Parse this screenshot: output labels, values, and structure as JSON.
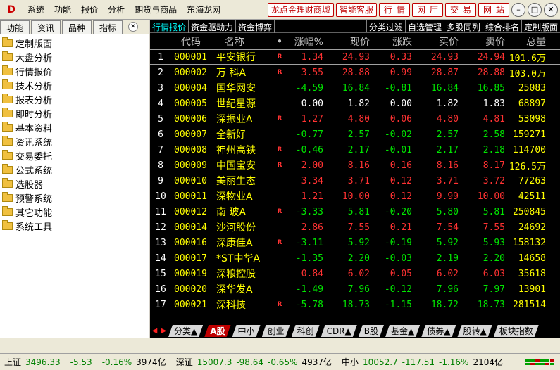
{
  "menubar": {
    "logo": "D",
    "items": [
      "系统",
      "功能",
      "报价",
      "分析",
      "期货与商品",
      "东海龙网"
    ],
    "ext_buttons": [
      "龙点金理财商城",
      "智能客服",
      "行情",
      "网厅",
      "交易",
      "网站"
    ],
    "window_buttons": [
      "minimize",
      "restore",
      "close"
    ]
  },
  "lefttabs": [
    "功能",
    "资讯",
    "品种",
    "指标"
  ],
  "tree": [
    "定制版面",
    "大盘分析",
    "行情报价",
    "技术分析",
    "报表分析",
    "即时分析",
    "基本资料",
    "资讯系统",
    "交易委托",
    "公式系统",
    "选股器",
    "预警系统",
    "其它功能",
    "系统工具"
  ],
  "viewtabs": {
    "left": [
      "行情报价",
      "资金驱动力",
      "资金博弈"
    ],
    "right": [
      "分类过滤",
      "自选管理",
      "多股同列",
      "综合排名",
      "定制版面"
    ]
  },
  "table": {
    "headers": {
      "code": "代码",
      "name": "名称",
      "dot": "•",
      "chg": "涨幅%",
      "price": "现价",
      "diff": "涨跌",
      "bid": "买价",
      "ask": "卖价",
      "vol": "总量"
    },
    "rows": [
      {
        "idx": "1",
        "code": "000001",
        "name": "平安银行",
        "flag": "R",
        "chg": "1.34",
        "price": "24.93",
        "diff": "0.33",
        "bid": "24.93",
        "ask": "24.94",
        "vol": "101.6万",
        "dir": "up"
      },
      {
        "idx": "2",
        "code": "000002",
        "name": "万 科A",
        "flag": "R",
        "chg": "3.55",
        "price": "28.88",
        "diff": "0.99",
        "bid": "28.87",
        "ask": "28.88",
        "vol": "103.0万",
        "dir": "up"
      },
      {
        "idx": "3",
        "code": "000004",
        "name": "国华网安",
        "flag": "",
        "chg": "-4.59",
        "price": "16.84",
        "diff": "-0.81",
        "bid": "16.84",
        "ask": "16.85",
        "vol": "25083",
        "dir": "down"
      },
      {
        "idx": "4",
        "code": "000005",
        "name": "世纪星源",
        "flag": "",
        "chg": "0.00",
        "price": "1.82",
        "diff": "0.00",
        "bid": "1.82",
        "ask": "1.83",
        "vol": "68897",
        "dir": "flat"
      },
      {
        "idx": "5",
        "code": "000006",
        "name": "深振业A",
        "flag": "R",
        "chg": "1.27",
        "price": "4.80",
        "diff": "0.06",
        "bid": "4.80",
        "ask": "4.81",
        "vol": "53098",
        "dir": "up"
      },
      {
        "idx": "6",
        "code": "000007",
        "name": "全新好",
        "flag": "",
        "chg": "-0.77",
        "price": "2.57",
        "diff": "-0.02",
        "bid": "2.57",
        "ask": "2.58",
        "vol": "159271",
        "dir": "down"
      },
      {
        "idx": "7",
        "code": "000008",
        "name": "神州高铁",
        "flag": "R",
        "chg": "-0.46",
        "price": "2.17",
        "diff": "-0.01",
        "bid": "2.17",
        "ask": "2.18",
        "vol": "114700",
        "dir": "down"
      },
      {
        "idx": "8",
        "code": "000009",
        "name": "中国宝安",
        "flag": "R",
        "chg": "2.00",
        "price": "8.16",
        "diff": "0.16",
        "bid": "8.16",
        "ask": "8.17",
        "vol": "126.5万",
        "dir": "up"
      },
      {
        "idx": "9",
        "code": "000010",
        "name": "美丽生态",
        "flag": "",
        "chg": "3.34",
        "price": "3.71",
        "diff": "0.12",
        "bid": "3.71",
        "ask": "3.72",
        "vol": "77263",
        "dir": "up"
      },
      {
        "idx": "10",
        "code": "000011",
        "name": "深物业A",
        "flag": "",
        "chg": "1.21",
        "price": "10.00",
        "diff": "0.12",
        "bid": "9.99",
        "ask": "10.00",
        "vol": "42511",
        "dir": "up"
      },
      {
        "idx": "11",
        "code": "000012",
        "name": "南 玻A",
        "flag": "R",
        "chg": "-3.33",
        "price": "5.81",
        "diff": "-0.20",
        "bid": "5.80",
        "ask": "5.81",
        "vol": "250845",
        "dir": "down"
      },
      {
        "idx": "12",
        "code": "000014",
        "name": "沙河股份",
        "flag": "",
        "chg": "2.86",
        "price": "7.55",
        "diff": "0.21",
        "bid": "7.54",
        "ask": "7.55",
        "vol": "24692",
        "dir": "up"
      },
      {
        "idx": "13",
        "code": "000016",
        "name": "深康佳A",
        "flag": "R",
        "chg": "-3.11",
        "price": "5.92",
        "diff": "-0.19",
        "bid": "5.92",
        "ask": "5.93",
        "vol": "158132",
        "dir": "down"
      },
      {
        "idx": "14",
        "code": "000017",
        "name": "*ST中华A",
        "flag": "",
        "chg": "-1.35",
        "price": "2.20",
        "diff": "-0.03",
        "bid": "2.19",
        "ask": "2.20",
        "vol": "14658",
        "dir": "down"
      },
      {
        "idx": "15",
        "code": "000019",
        "name": "深粮控股",
        "flag": "",
        "chg": "0.84",
        "price": "6.02",
        "diff": "0.05",
        "bid": "6.02",
        "ask": "6.03",
        "vol": "35618",
        "dir": "up"
      },
      {
        "idx": "16",
        "code": "000020",
        "name": "深华发A",
        "flag": "",
        "chg": "-1.49",
        "price": "7.96",
        "diff": "-0.12",
        "bid": "7.96",
        "ask": "7.97",
        "vol": "13901",
        "dir": "down"
      },
      {
        "idx": "17",
        "code": "000021",
        "name": "深科技",
        "flag": "R",
        "chg": "-5.78",
        "price": "18.73",
        "diff": "-1.15",
        "bid": "18.72",
        "ask": "18.73",
        "vol": "281514",
        "dir": "down"
      }
    ]
  },
  "bottomtabs": [
    "分类▲",
    "A股",
    "中小",
    "创业",
    "科创",
    "CDR▲",
    "B股",
    "基金▲",
    "债券▲",
    "股转▲",
    "板块指数"
  ],
  "bottomtabs_active": "A股",
  "statusbar": {
    "sh": {
      "label": "上证",
      "value": "3496.33",
      "chg": "-5.53",
      "pct": "-0.16%",
      "amt": "3974亿"
    },
    "sz": {
      "label": "深证",
      "value": "15007.3",
      "chg": "-98.64",
      "pct": "-0.65%",
      "amt": "4937亿"
    },
    "zx": {
      "label": "中小",
      "value": "10052.7",
      "chg": "-117.51",
      "pct": "-1.16%",
      "amt": "2104亿"
    }
  },
  "colors": {
    "up": "#ff3232",
    "down": "#00e600",
    "flat": "#ffffff",
    "code": "#ffff00",
    "active_tab": "#00ffff",
    "accent_red": "#c00000"
  }
}
